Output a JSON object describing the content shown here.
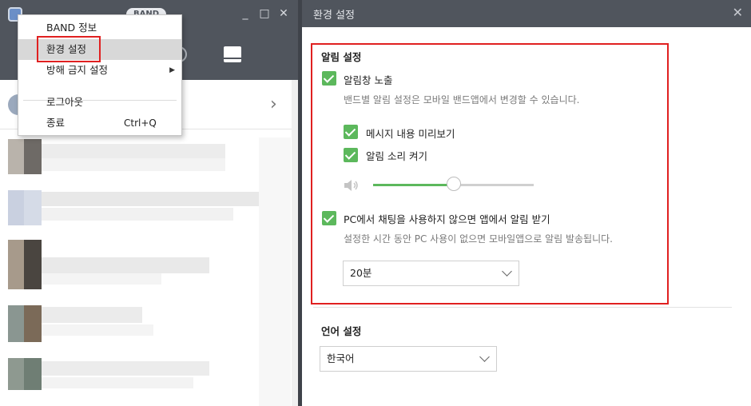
{
  "left_window": {
    "band_logo": "BAND",
    "win_minimize": "_",
    "win_maximize": "□",
    "win_close": "✕"
  },
  "context_menu": {
    "items": [
      {
        "label": "BAND 정보"
      },
      {
        "label": "환경 설정",
        "highlighted": true
      },
      {
        "label": "방해 금지 설정",
        "submenu_arrow": "▶"
      },
      {
        "label": "로그아웃"
      },
      {
        "label": "종료",
        "shortcut": "Ctrl+Q"
      }
    ]
  },
  "settings": {
    "title": "환경 설정",
    "close": "✕",
    "notification_section": {
      "title": "알림 설정",
      "notification_popup": {
        "label": "알림창 노출",
        "checked": true
      },
      "popup_description": "밴드별 알림 설정은 모바일 밴드앱에서 변경할 수 있습니다.",
      "message_preview": {
        "label": "메시지 내용 미리보기",
        "checked": true
      },
      "sound_on": {
        "label": "알림 소리 켜기",
        "checked": true
      },
      "volume_level": 0.5,
      "pc_idle_alert": {
        "label": "PC에서 채팅을 사용하지 않으면 앱에서 알림 받기",
        "checked": true
      },
      "idle_description": "설정한 시간 동안 PC 사용이 없으면 모바일앱으로 알림 발송됩니다.",
      "idle_time": {
        "value": "20분"
      }
    },
    "language_section": {
      "title": "언어 설정",
      "language": {
        "value": "한국어"
      }
    }
  },
  "colors": {
    "accent_green": "#5cb85c",
    "highlight_red": "#e02020",
    "titlebar": "#50555d"
  }
}
